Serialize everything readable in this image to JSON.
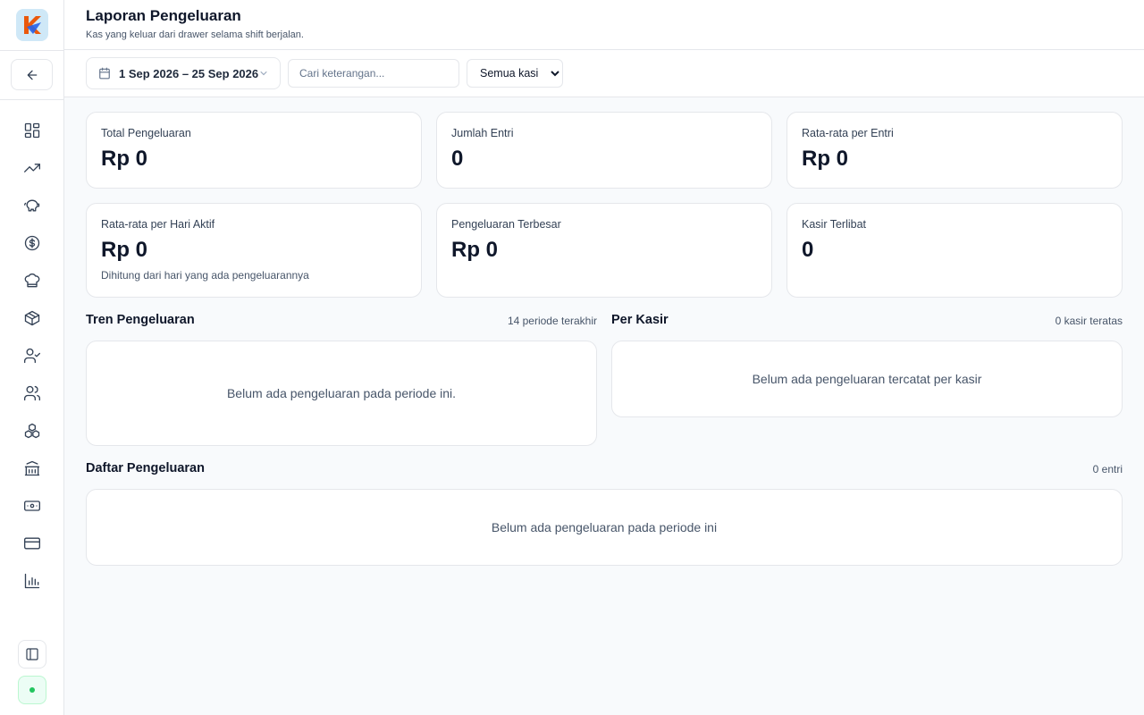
{
  "header": {
    "title": "Laporan Pengeluaran",
    "subtitle": "Kas yang keluar dari drawer selama shift berjalan."
  },
  "sidebar": {
    "logo_icon": "app-logo",
    "back_icon": "arrow-left-icon",
    "items": [
      {
        "icon": "dashboard-icon"
      },
      {
        "icon": "trending-up-icon"
      },
      {
        "icon": "piggy-bank-icon"
      },
      {
        "icon": "dollar-circle-icon"
      },
      {
        "icon": "chef-hat-icon"
      },
      {
        "icon": "package-icon"
      },
      {
        "icon": "user-check-icon"
      },
      {
        "icon": "users-icon"
      },
      {
        "icon": "boxes-icon"
      },
      {
        "icon": "bank-icon"
      },
      {
        "icon": "banknote-icon"
      },
      {
        "icon": "credit-card-icon"
      },
      {
        "icon": "bar-chart-icon"
      }
    ],
    "collapse_icon": "panel-left-icon",
    "status_color": "#22c55e"
  },
  "filters": {
    "date_range": "1 Sep 2026 – 25 Sep 2026",
    "search_placeholder": "Cari keterangan...",
    "cashier_selected": "Semua kasir"
  },
  "stats": [
    {
      "label": "Total Pengeluaran",
      "value": "Rp 0",
      "note": ""
    },
    {
      "label": "Jumlah Entri",
      "value": "0",
      "note": ""
    },
    {
      "label": "Rata-rata per Entri",
      "value": "Rp 0",
      "note": ""
    },
    {
      "label": "Rata-rata per Hari Aktif",
      "value": "Rp 0",
      "note": "Dihitung dari hari yang ada pengeluarannya"
    },
    {
      "label": "Pengeluaran Terbesar",
      "value": "Rp 0",
      "note": ""
    },
    {
      "label": "Kasir Terlibat",
      "value": "0",
      "note": ""
    }
  ],
  "trend": {
    "title": "Tren Pengeluaran",
    "meta": "14 periode terakhir",
    "empty": "Belum ada pengeluaran pada periode ini."
  },
  "per_cashier": {
    "title": "Per Kasir",
    "meta": "0 kasir teratas",
    "empty": "Belum ada pengeluaran tercatat per kasir"
  },
  "list": {
    "title": "Daftar Pengeluaran",
    "meta": "0 entri",
    "empty": "Belum ada pengeluaran pada periode ini"
  }
}
